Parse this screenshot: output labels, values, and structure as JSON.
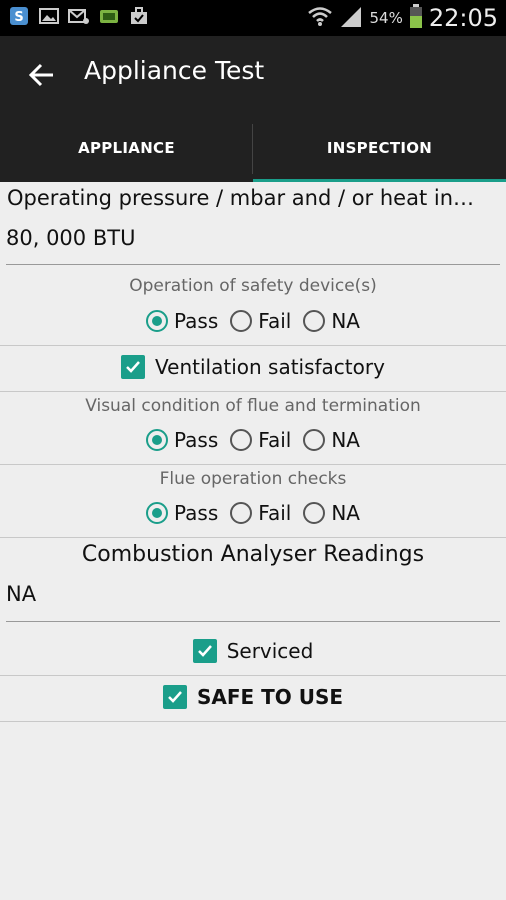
{
  "status_bar": {
    "battery": "54%",
    "time": "22:05",
    "icons": [
      "s-app-icon",
      "gallery-icon",
      "email-icon",
      "android-debug-icon",
      "briefcase-check-icon",
      "wifi-icon",
      "signal-icon",
      "battery-icon"
    ]
  },
  "toolbar": {
    "title": "Appliance Test"
  },
  "tabs": [
    {
      "label": "APPLIANCE",
      "active": false
    },
    {
      "label": "INSPECTION",
      "active": true
    }
  ],
  "form": {
    "pressure_label": "Operating pressure / mbar and / or heat in…",
    "pressure_value": "80, 000 BTU",
    "safety_device": {
      "question": "Operation of safety device(s)",
      "selected": "Pass"
    },
    "ventilation": {
      "label": "Ventilation satisfactory",
      "checked": true
    },
    "flue_condition": {
      "question": "Visual condition of flue and termination",
      "selected": "Pass"
    },
    "flue_operation": {
      "question": "Flue operation checks",
      "selected": "Pass"
    },
    "options": {
      "pass": "Pass",
      "fail": "Fail",
      "na": "NA"
    },
    "combustion_title": "Combustion Analyser Readings",
    "combustion_value": "NA",
    "serviced": {
      "label": "Serviced",
      "checked": true
    },
    "safe_to_use": {
      "label": "SAFE TO USE",
      "checked": true
    }
  },
  "colors": {
    "accent": "#1a9e8a",
    "toolbar": "#212121",
    "background": "#eeeeee"
  }
}
